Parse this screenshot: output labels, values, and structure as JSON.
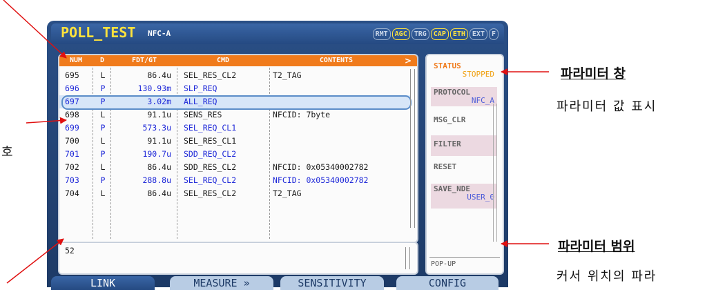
{
  "header": {
    "title": "POLL_TEST",
    "subtitle": "NFC-A",
    "badges": [
      {
        "label": "RMT",
        "active": false
      },
      {
        "label": "AGC",
        "active": true
      },
      {
        "label": "TRG",
        "active": false
      },
      {
        "label": "CAP",
        "active": true
      },
      {
        "label": "ETH",
        "active": true
      },
      {
        "label": "EXT",
        "active": false
      },
      {
        "label": "F",
        "active": false
      }
    ]
  },
  "table": {
    "columns": [
      "NUM",
      "D",
      "FDT/GT",
      "CMD",
      "CONTENTS"
    ],
    "next_arrow": ">",
    "rows": [
      {
        "num": "695",
        "d": "L",
        "fdt": "86.4u",
        "cmd": "SEL_RES_CL2",
        "contents": "T2_TAG"
      },
      {
        "num": "696",
        "d": "P",
        "fdt": "130.93m",
        "cmd": "SLP_REQ",
        "contents": ""
      },
      {
        "num": "697",
        "d": "P",
        "fdt": "3.02m",
        "cmd": "ALL_REQ",
        "contents": "",
        "selected": true
      },
      {
        "num": "698",
        "d": "L",
        "fdt": "91.1u",
        "cmd": "SENS_RES",
        "contents": "NFCID: 7byte"
      },
      {
        "num": "699",
        "d": "P",
        "fdt": "573.3u",
        "cmd": "SEL_REQ_CL1",
        "contents": ""
      },
      {
        "num": "700",
        "d": "L",
        "fdt": "91.1u",
        "cmd": "SEL_RES_CL1",
        "contents": ""
      },
      {
        "num": "701",
        "d": "P",
        "fdt": "190.7u",
        "cmd": "SDD_REQ_CL2",
        "contents": ""
      },
      {
        "num": "702",
        "d": "L",
        "fdt": "86.4u",
        "cmd": "SDD_RES_CL2",
        "contents": "NFCID: 0x05340002782"
      },
      {
        "num": "703",
        "d": "P",
        "fdt": "288.8u",
        "cmd": "SEL_REQ_CL2",
        "contents": "NFCID: 0x05340002782"
      },
      {
        "num": "704",
        "d": "L",
        "fdt": "86.4u",
        "cmd": "SEL_RES_CL2",
        "contents": "T2_TAG"
      }
    ]
  },
  "input": {
    "value": "52"
  },
  "params": {
    "status_label": "STATUS",
    "status_value": "STOPPED",
    "protocol_label": "PROTOCOL",
    "protocol_value": "NFC_A",
    "msg_clr": "MSG_CLR",
    "filter": "FILTER",
    "reset": "RESET",
    "save_label": "SAVE_NDE",
    "save_value": "USER_0",
    "popup": "POP-UP"
  },
  "tabs": [
    "LINK",
    "MEASURE »",
    "SENSITIVITY",
    "CONFIG"
  ],
  "annotations": {
    "param_window_title": "파라미터 창",
    "param_window_desc": "파라미터 값 표시",
    "param_range_title": "파라미터 범위",
    "param_range_desc": "커서 위치의 파라",
    "left_fragment": "호"
  },
  "colors": {
    "header_orange": "#f07b1c",
    "title_yellow": "#ffe23c",
    "p_row_blue": "#1d27d8",
    "frame_blue": "#254a82"
  }
}
